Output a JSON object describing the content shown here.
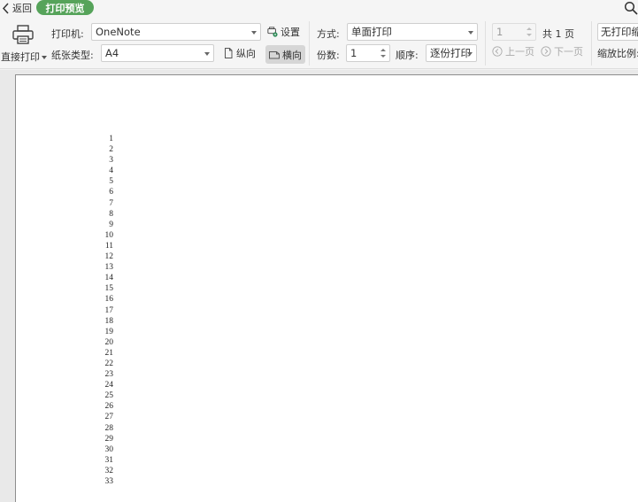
{
  "topbar": {
    "back_label": "返回",
    "mode_label": "打印预览",
    "search_icon": "search-icon"
  },
  "ribbon": {
    "direct_print_label": "直接打印",
    "printer_label": "打印机:",
    "printer_value": "OneNote",
    "paper_type_label": "纸张类型:",
    "paper_type_value": "A4",
    "settings_label": "设置",
    "portrait_label": "纵向",
    "landscape_label": "横向",
    "landscape_active": true,
    "method_label": "方式:",
    "method_value": "单面打印",
    "copies_label": "份数:",
    "copies_value": "1",
    "order_label": "顺序:",
    "order_value": "逐份打印",
    "page_value": "1",
    "total_pages_label": "共 1 页",
    "prev_page_label": "上一页",
    "next_page_label": "下一页",
    "no_scale_value": "无打印缩",
    "scale_label": "缩放比例:"
  },
  "preview": {
    "row_numbers": [
      "1",
      "2",
      "3",
      "4",
      "5",
      "6",
      "7",
      "8",
      "9",
      "10",
      "11",
      "12",
      "13",
      "14",
      "15",
      "16",
      "17",
      "18",
      "19",
      "20",
      "21",
      "22",
      "23",
      "24",
      "25",
      "26",
      "27",
      "28",
      "29",
      "30",
      "31",
      "32",
      "33"
    ]
  }
}
